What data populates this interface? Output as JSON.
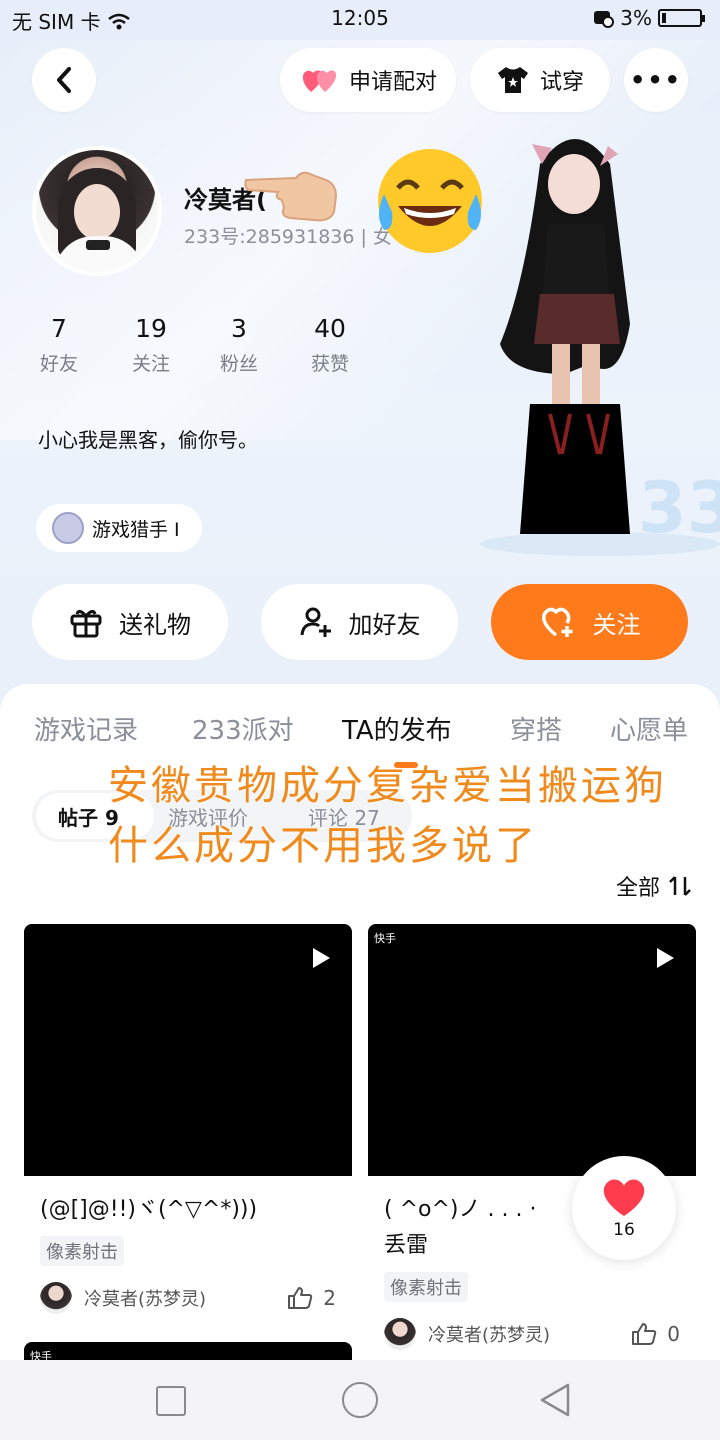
{
  "status_bar": {
    "carrier": "无 SIM 卡",
    "time": "12:05",
    "battery": "3%"
  },
  "header": {
    "pair_label": "申请配对",
    "try_on_label": "试穿",
    "more_label": "•••"
  },
  "profile": {
    "name": "冷莫者(",
    "name_suffix": ")",
    "uid": "233号:285931836 | 女"
  },
  "stats": [
    {
      "value": "7",
      "label": "好友"
    },
    {
      "value": "19",
      "label": "关注"
    },
    {
      "value": "3",
      "label": "粉丝"
    },
    {
      "value": "40",
      "label": "获赞"
    }
  ],
  "bio": "小心我是黑客，偷你号。",
  "badge": "游戏猎手 I",
  "actions": {
    "gift": "送礼物",
    "add_friend": "加好友",
    "follow": "关注"
  },
  "tabs": [
    {
      "label": "游戏记录",
      "active": false
    },
    {
      "label": "233派对",
      "active": false
    },
    {
      "label": "TA的发布",
      "active": true
    },
    {
      "label": "穿搭",
      "active": false
    },
    {
      "label": "心愿单",
      "active": false
    }
  ],
  "subtabs": [
    {
      "label": "帖子 9",
      "active": true
    },
    {
      "label": "游戏评价",
      "active": false
    },
    {
      "label": "评论 27",
      "active": false
    }
  ],
  "overlay_text": "安徽贵物成分复杂爱当搬运狗什么成分不用我多说了",
  "sort_label": "全部",
  "posts": [
    {
      "title": "(@[]@!!)ヾ(^▽^*)))",
      "tag": "像素射击",
      "author": "冷莫者(苏梦灵)",
      "likes": "2",
      "watermark": ""
    },
    {
      "title": "( ^o^)ノ . . . ·\n丢雷",
      "tag": "像素射击",
      "author": "冷莫者(苏梦灵)",
      "likes": "0",
      "watermark": "快手"
    }
  ],
  "partial_card_watermark": "快手",
  "floating_like": {
    "count": "16"
  },
  "colors": {
    "accent": "#ff7a1a",
    "overlay_text": "#f08a1c",
    "panel": "#ffffff"
  }
}
